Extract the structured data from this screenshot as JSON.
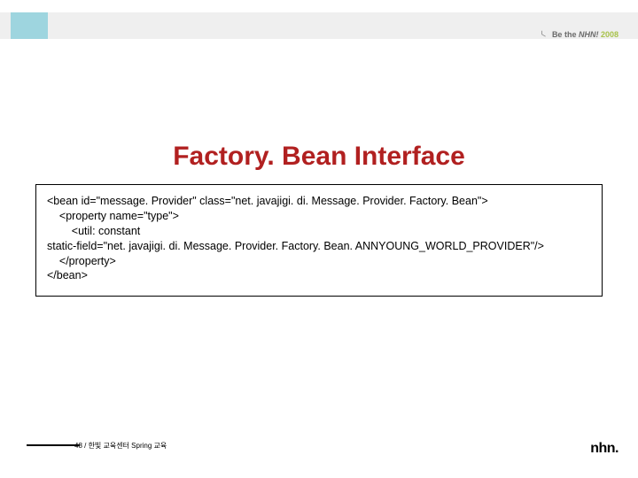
{
  "tagline": {
    "prefix": "Be the ",
    "brand": "NHN!",
    "year": "2008"
  },
  "title": "Factory. Bean Interface",
  "code": "<bean id=\"message. Provider\" class=\"net. javajigi. di. Message. Provider. Factory. Bean\">\n    <property name=\"type\">\n        <util: constant\nstatic-field=\"net. javajigi. di. Message. Provider. Factory. Bean. ANNYOUNG_WORLD_PROVIDER\"/>\n    </property>\n</bean>",
  "footer": "48 / 한빛 교육센터 Spring 교육",
  "logo": "nhn."
}
